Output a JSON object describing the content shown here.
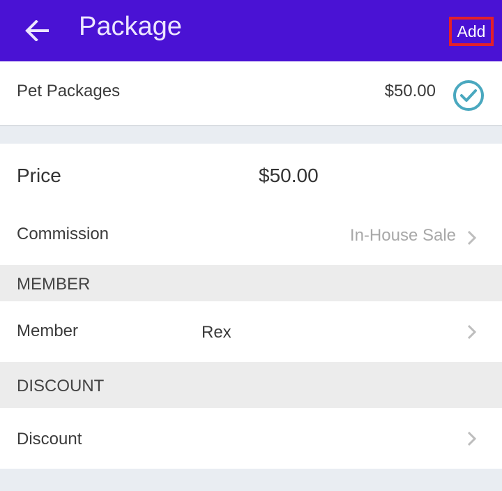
{
  "appbar": {
    "title": "Package",
    "add_label": "Add",
    "back_icon": "arrow-left-icon"
  },
  "package": {
    "name": "Pet Packages",
    "price": "$50.00",
    "selected_icon": "check-circle-icon"
  },
  "details": {
    "price_label": "Price",
    "price_value": "$50.00",
    "commission_label": "Commission",
    "commission_value": "In-House Sale"
  },
  "member_section": {
    "header": "MEMBER",
    "label": "Member",
    "value": "Rex"
  },
  "discount_section": {
    "header": "DISCOUNT",
    "label": "Discount"
  },
  "colors": {
    "appbar": "#4a12d4",
    "highlight_border": "#e3202a",
    "check": "#4aa8bf"
  }
}
